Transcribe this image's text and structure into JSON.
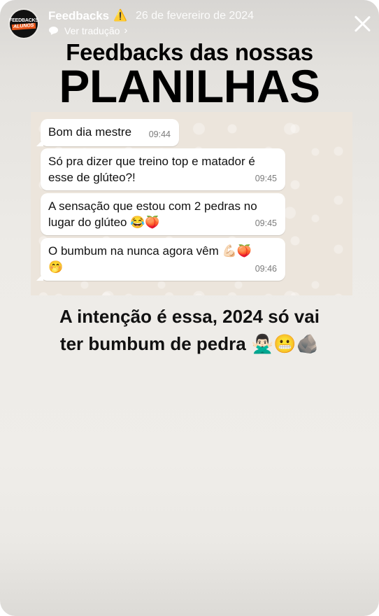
{
  "header": {
    "account_name": "Feedbacks",
    "warning_emoji": "⚠️",
    "date": "26 de fevereiro de 2024",
    "translate_label": "Ver tradução",
    "chevron": "›",
    "avatar_line1": "FEEDBACKS",
    "avatar_line2": "ALUNOS"
  },
  "title": {
    "line1": "Feedbacks das nossas",
    "line2": "PLANILHAS"
  },
  "chat": {
    "messages": [
      {
        "line1": "Bom dia mestre",
        "line2": "",
        "time": "09:44"
      },
      {
        "line1": "Só pra dizer que treino top e matador é",
        "line2": "esse de glúteo?!",
        "time": "09:45"
      },
      {
        "line1": "A sensação que estou com 2 pedras no",
        "line2": "lugar do glúteo 😂🍑",
        "time": "09:45"
      },
      {
        "line1": "O bumbum na nunca agora vêm  💪🏻🍑",
        "line2": "🤭",
        "time": "09:46"
      }
    ]
  },
  "caption": {
    "line1": "A intenção é essa, 2024 só vai",
    "line2": "ter bumbum de pedra 🙅🏻‍♂️😬🪨"
  }
}
